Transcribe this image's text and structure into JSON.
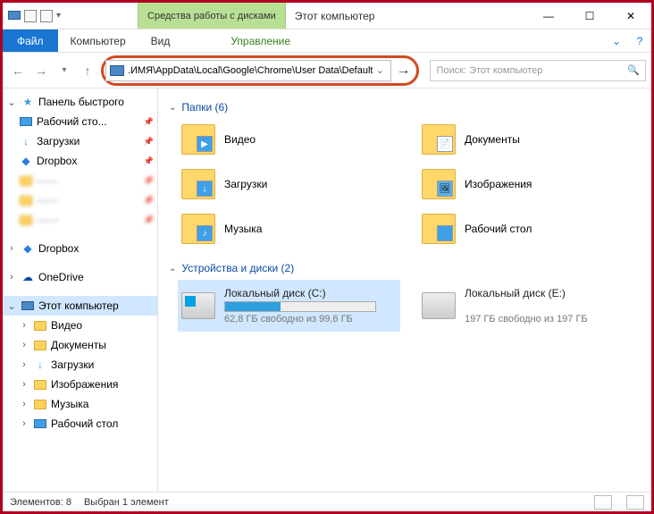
{
  "window": {
    "ctx_tab": "Средства работы с дисками",
    "title": "Этот компьютер"
  },
  "ribbon": {
    "file": "Файл",
    "tab_computer": "Компьютер",
    "tab_view": "Вид",
    "tab_manage": "Управление"
  },
  "address": {
    "path": ".ИМЯ\\AppData\\Local\\Google\\Chrome\\User Data\\Default"
  },
  "search": {
    "placeholder": "Поиск: Этот компьютер"
  },
  "sidebar": {
    "quick_access": "Панель быстрого",
    "desktop": "Рабочий сто...",
    "downloads": "Загрузки",
    "dropbox_pin": "Dropbox",
    "dropbox": "Dropbox",
    "onedrive": "OneDrive",
    "this_pc": "Этот компьютер",
    "video": "Видео",
    "documents": "Документы",
    "downloads2": "Загрузки",
    "pictures": "Изображения",
    "music": "Музыка",
    "desktop2": "Рабочий стол"
  },
  "groups": {
    "folders": "Папки (6)",
    "drives": "Устройства и диски (2)"
  },
  "folders": {
    "video": "Видео",
    "documents": "Документы",
    "downloads": "Загрузки",
    "pictures": "Изображения",
    "music": "Музыка",
    "desktop": "Рабочий стол"
  },
  "drives": {
    "c_name": "Локальный диск (C:)",
    "c_sub": "62,8 ГБ свободно из 99,6 ГБ",
    "c_fill_pct": 37,
    "e_name": "Локальный диск (E:)",
    "e_sub": "197 ГБ свободно из 197 ГБ"
  },
  "status": {
    "count": "Элементов: 8",
    "selected": "Выбран 1 элемент"
  }
}
